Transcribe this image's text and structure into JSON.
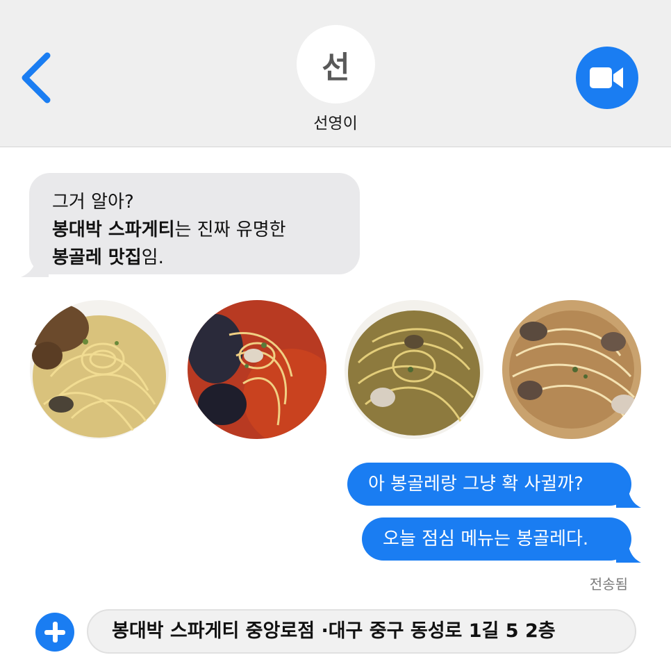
{
  "header": {
    "back_icon": "chevron-left-icon",
    "avatar_initial": "선",
    "contact_name": "선영이",
    "video_icon": "video-camera-icon",
    "accent_color": "#1a7df2",
    "background_color": "#efefef"
  },
  "messages": {
    "incoming": {
      "line1": "그거 알아?",
      "line2_bold": "봉대박 스파게티",
      "line2_rest": "는 진짜 유명한",
      "line3_bold": "봉골레 맛집",
      "line3_rest": "임."
    },
    "photos": [
      "pasta-photo-1",
      "pasta-photo-2",
      "pasta-photo-3",
      "pasta-photo-4"
    ],
    "outgoing": [
      "아 봉골레랑 그냥 확 사귈까?",
      "오늘 점심 메뉴는 봉골레다."
    ],
    "status": "전송됨"
  },
  "composer": {
    "plus_icon": "plus-icon",
    "input_value": "봉대박 스파게티 중앙로점 ·대구 중구 동성로 1길 5 2층"
  }
}
